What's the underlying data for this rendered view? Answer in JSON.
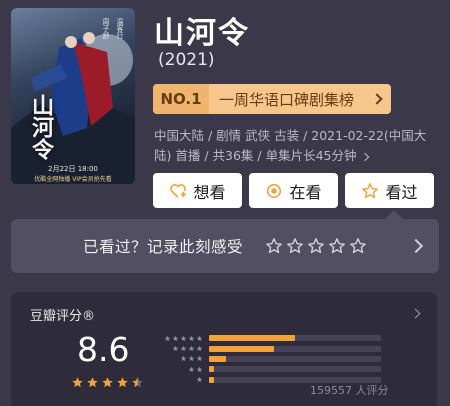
{
  "poster": {
    "title": "山河令",
    "credit_left": "周子舒",
    "credit_right": "温客行",
    "date_text": "2月22日 18:00",
    "note_text": "优酷全网独播 VIP会员抢先看"
  },
  "movie": {
    "title": "山河令",
    "year": "(2021)"
  },
  "rank": {
    "no": "NO.1",
    "label": "一周华语口碑剧集榜"
  },
  "meta": {
    "line": "中国大陆 / 剧情 武侠 古装 / 2021-02-22(中国大陆) 首播 / 共36集 / 单集片长45分钟"
  },
  "actions": {
    "want_label": "想看",
    "watching_label": "在看",
    "watched_label": "看过"
  },
  "seen_bar": {
    "text": "已看过？记录此刻感受"
  },
  "rating": {
    "title": "豆瓣评分®",
    "score": "8.6",
    "stars_value": 4.5,
    "distribution": [
      {
        "stars": 5,
        "fraction": 0.5
      },
      {
        "stars": 4,
        "fraction": 0.38
      },
      {
        "stars": 3,
        "fraction": 0.1
      },
      {
        "stars": 2,
        "fraction": 0.03
      },
      {
        "stars": 1,
        "fraction": 0.03
      }
    ],
    "votes": "159557 人评分"
  },
  "colors": {
    "background": "#3a3849",
    "accent_star": "#f3a23a",
    "rank_badge": "#f6c68d"
  }
}
